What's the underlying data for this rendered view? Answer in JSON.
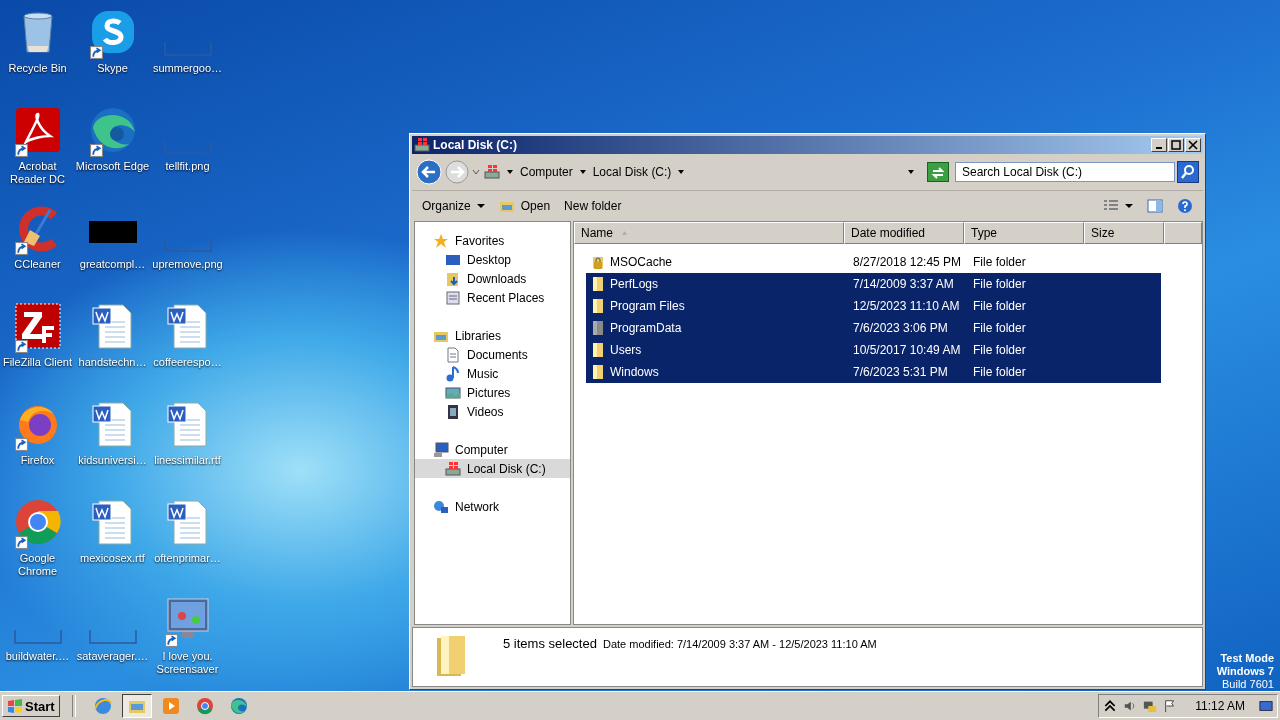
{
  "desktop_icons": [
    {
      "label": "Recycle Bin",
      "kind": "recycle",
      "shortcut": false
    },
    {
      "label": "Acrobat Reader DC",
      "kind": "acrobat",
      "shortcut": true
    },
    {
      "label": "CCleaner",
      "kind": "ccleaner",
      "shortcut": true
    },
    {
      "label": "FileZilla Client",
      "kind": "filezilla",
      "shortcut": true
    },
    {
      "label": "Firefox",
      "kind": "firefox",
      "shortcut": true
    },
    {
      "label": "Google Chrome",
      "kind": "chrome",
      "shortcut": true
    },
    {
      "label": "buildwater.…",
      "kind": "blank",
      "shortcut": false
    },
    {
      "label": "Skype",
      "kind": "skype",
      "shortcut": true
    },
    {
      "label": "Microsoft Edge",
      "kind": "edge",
      "shortcut": true
    },
    {
      "label": "greatcompl…",
      "kind": "black",
      "shortcut": false
    },
    {
      "label": "handstechn…",
      "kind": "word",
      "shortcut": false
    },
    {
      "label": "kidsuniversi…",
      "kind": "word",
      "shortcut": false
    },
    {
      "label": "mexicosex.rtf",
      "kind": "word",
      "shortcut": false
    },
    {
      "label": "sataverager.…",
      "kind": "blank",
      "shortcut": false
    },
    {
      "label": "summergoo…",
      "kind": "blank",
      "shortcut": false
    },
    {
      "label": "tellfit.png",
      "kind": "blank",
      "shortcut": false
    },
    {
      "label": "upremove.png",
      "kind": "blank",
      "shortcut": false
    },
    {
      "label": "coffeerespo…",
      "kind": "word",
      "shortcut": false
    },
    {
      "label": "linessimilar.rtf",
      "kind": "word",
      "shortcut": false
    },
    {
      "label": "oftenprimar…",
      "kind": "word",
      "shortcut": false
    },
    {
      "label": "I love you. Screensaver",
      "kind": "screensaver",
      "shortcut": true
    }
  ],
  "window": {
    "title": "Local Disk (C:)",
    "breadcrumb": [
      "Computer",
      "Local Disk (C:)"
    ],
    "search": {
      "placeholder": "Search Local Disk (C:)"
    },
    "toolbar": [
      {
        "label": "Organize",
        "kind": "menu"
      },
      {
        "label": "Open",
        "kind": "open"
      },
      {
        "label": "New folder",
        "kind": "plain"
      }
    ],
    "nav": [
      {
        "label": "Favorites",
        "kind": "star",
        "selected": false,
        "children": [
          {
            "label": "Desktop",
            "kind": "desktop",
            "selected": false
          },
          {
            "label": "Downloads",
            "kind": "downloads",
            "selected": false
          },
          {
            "label": "Recent Places",
            "kind": "recent",
            "selected": false
          }
        ]
      },
      {
        "label": "Libraries",
        "kind": "libraries",
        "selected": false,
        "children": [
          {
            "label": "Documents",
            "kind": "documents",
            "selected": false
          },
          {
            "label": "Music",
            "kind": "music",
            "selected": false
          },
          {
            "label": "Pictures",
            "kind": "pictures",
            "selected": false
          },
          {
            "label": "Videos",
            "kind": "videos",
            "selected": false
          }
        ]
      },
      {
        "label": "Computer",
        "kind": "computer",
        "selected": false,
        "children": [
          {
            "label": "Local Disk (C:)",
            "kind": "disk",
            "selected": true
          }
        ]
      },
      {
        "label": "Network",
        "kind": "network",
        "selected": false
      }
    ],
    "columns": [
      {
        "label": "Name",
        "sorted": true
      },
      {
        "label": "Date modified",
        "sorted": false
      },
      {
        "label": "Type",
        "sorted": false
      },
      {
        "label": "Size",
        "sorted": false
      }
    ],
    "rows": [
      {
        "name": "MSOCache",
        "date": "8/27/2018 12:45 PM",
        "type": "File folder",
        "kind": "locked",
        "selected": false
      },
      {
        "name": "PerfLogs",
        "date": "7/14/2009 3:37 AM",
        "type": "File folder",
        "kind": "folder",
        "selected": true
      },
      {
        "name": "Program Files",
        "date": "12/5/2023 11:10 AM",
        "type": "File folder",
        "kind": "folder",
        "selected": true
      },
      {
        "name": "ProgramData",
        "date": "7/6/2023 3:06 PM",
        "type": "File folder",
        "kind": "hidden",
        "selected": true
      },
      {
        "name": "Users",
        "date": "10/5/2017 10:49 AM",
        "type": "File folder",
        "kind": "folder",
        "selected": true
      },
      {
        "name": "Windows",
        "date": "7/6/2023 5:31 PM",
        "type": "File folder",
        "kind": "folder",
        "selected": true
      }
    ],
    "details": {
      "summary": "5 items selected",
      "date_range": "Date modified: 7/14/2009 3:37 AM - 12/5/2023 11:10 AM"
    }
  },
  "test_mode": [
    "Test Mode",
    "Windows 7",
    "Build 7601"
  ],
  "taskbar": {
    "start": "Start",
    "apps": [
      {
        "kind": "ie",
        "active": false
      },
      {
        "kind": "explorer",
        "active": true
      },
      {
        "kind": "media",
        "active": false
      },
      {
        "kind": "chrome",
        "active": false
      },
      {
        "kind": "edge",
        "active": false
      }
    ],
    "clock": "11:12 AM"
  }
}
